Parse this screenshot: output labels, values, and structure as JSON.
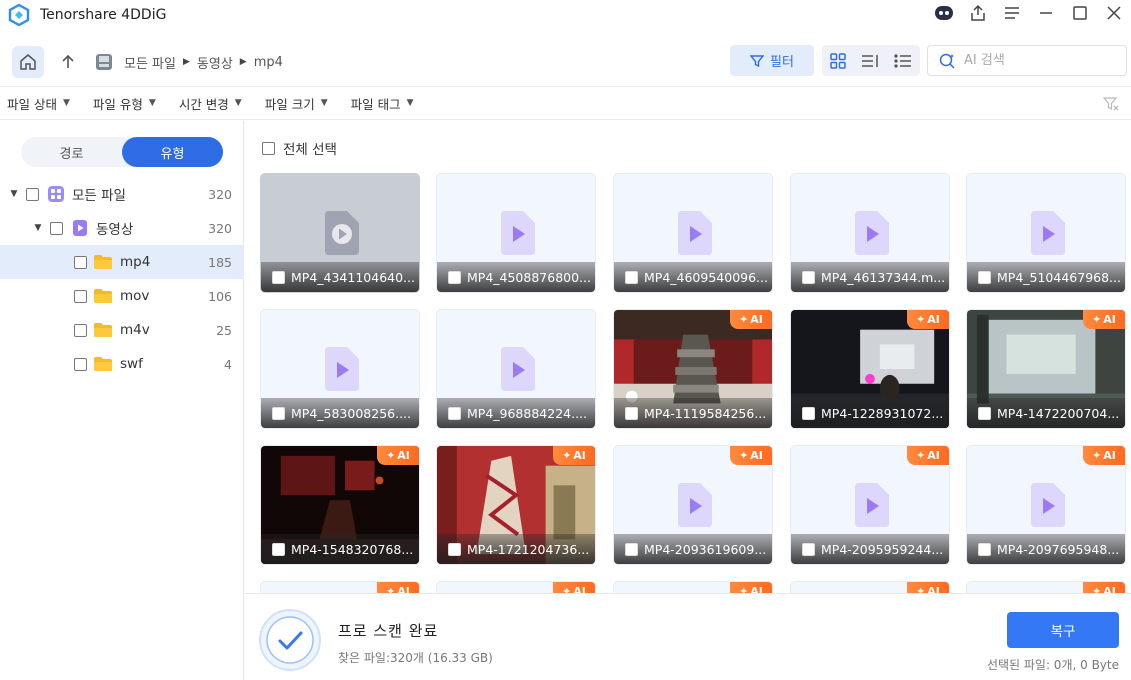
{
  "app": {
    "title": "Tenorshare 4DDiG"
  },
  "toolbar": {
    "breadcrumb": [
      "모든 파일",
      "동영상",
      "mp4"
    ],
    "filter_label": "필터",
    "search_placeholder": "AI 검색"
  },
  "filters": [
    "파일 상태",
    "파일 유형",
    "시간 변경",
    "파일 크기",
    "파일 태그"
  ],
  "sidebar": {
    "tabs": [
      "경로",
      "유형"
    ],
    "active_tab": "유형",
    "tree": [
      {
        "label": "모든 파일",
        "count": "320"
      },
      {
        "label": "동영상",
        "count": "320"
      },
      {
        "label": "mp4",
        "count": "185",
        "selected": true
      },
      {
        "label": "mov",
        "count": "106"
      },
      {
        "label": "m4v",
        "count": "25"
      },
      {
        "label": "swf",
        "count": "4"
      }
    ]
  },
  "content": {
    "select_all_label": "전체 선택",
    "ai_badge": "AI",
    "files": [
      {
        "name": "MP4_4341104640...",
        "ai": false
      },
      {
        "name": "MP4_4508876800...",
        "ai": false
      },
      {
        "name": "MP4_4609540096...",
        "ai": false
      },
      {
        "name": "MP4_46137344.m...",
        "ai": false
      },
      {
        "name": "MP4_5104467968...",
        "ai": false
      },
      {
        "name": "MP4_583008256....",
        "ai": false
      },
      {
        "name": "MP4_968884224....",
        "ai": false
      },
      {
        "name": "MP4-1119584256...",
        "ai": true
      },
      {
        "name": "MP4-1228931072...",
        "ai": true
      },
      {
        "name": "MP4-1472200704...",
        "ai": true
      },
      {
        "name": "MP4-1548320768...",
        "ai": true
      },
      {
        "name": "MP4-1721204736...",
        "ai": true
      },
      {
        "name": "MP4-2093619609...",
        "ai": true
      },
      {
        "name": "MP4-2095959244...",
        "ai": true
      },
      {
        "name": "MP4-2097695948...",
        "ai": true
      }
    ]
  },
  "footer": {
    "status_title": "프로 스캔 완료",
    "found_files": "찾은 파일:320개 (16.33 GB)",
    "recover_label": "복구",
    "selected_info": "선택된 파일: 0개, 0 Byte"
  },
  "colors": {
    "accent": "#3478f6",
    "ai_badge": "#ff7a2f"
  }
}
